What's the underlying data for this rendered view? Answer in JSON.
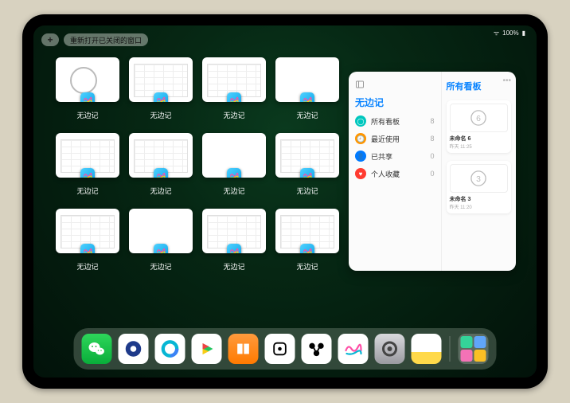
{
  "status": {
    "signal": "􀙇",
    "battery_text": "100%",
    "wifi": true
  },
  "top": {
    "plus_label": "+",
    "reopen_label": "重新打开已关闭的窗口"
  },
  "windows": [
    {
      "label": "无边记",
      "kind": "doodle"
    },
    {
      "label": "无边记",
      "kind": "grid"
    },
    {
      "label": "无边记",
      "kind": "grid"
    },
    {
      "label": "无边记",
      "kind": "blank"
    },
    {
      "label": "无边记",
      "kind": "grid"
    },
    {
      "label": "无边记",
      "kind": "grid"
    },
    {
      "label": "无边记",
      "kind": "blank"
    },
    {
      "label": "无边记",
      "kind": "grid"
    },
    {
      "label": "无边记",
      "kind": "grid"
    },
    {
      "label": "无边记",
      "kind": "blank"
    },
    {
      "label": "无边记",
      "kind": "grid"
    },
    {
      "label": "无边记",
      "kind": "grid"
    }
  ],
  "panel": {
    "title": "无边记",
    "right_title": "所有看板",
    "categories": [
      {
        "icon": "circle",
        "color": "#00c7be",
        "label": "所有看板",
        "count": 8
      },
      {
        "icon": "clock",
        "color": "#ff9500",
        "label": "最近使用",
        "count": 8
      },
      {
        "icon": "person",
        "color": "#007aff",
        "label": "已共享",
        "count": 0
      },
      {
        "icon": "heart",
        "color": "#ff3b30",
        "label": "个人收藏",
        "count": 0
      }
    ],
    "boards": [
      {
        "name": "未命名 6",
        "time": "昨天 11:25",
        "glyph": "6"
      },
      {
        "name": "未命名 3",
        "time": "昨天 11:20",
        "glyph": "3"
      }
    ]
  },
  "dock": {
    "apps": [
      {
        "name": "wechat",
        "bg": "linear-gradient(#2dd65a,#09ad3a)",
        "glyph": "wechat"
      },
      {
        "name": "browser1",
        "bg": "#ffffff",
        "glyph": "donut-blue"
      },
      {
        "name": "browser2",
        "bg": "#ffffff",
        "glyph": "ring-cyan"
      },
      {
        "name": "play",
        "bg": "#ffffff",
        "glyph": "play"
      },
      {
        "name": "books",
        "bg": "linear-gradient(#ff9a3d,#ff7a00)",
        "glyph": "books"
      },
      {
        "name": "dice",
        "bg": "#ffffff",
        "glyph": "dice"
      },
      {
        "name": "connect",
        "bg": "#ffffff",
        "glyph": "nodes"
      },
      {
        "name": "freeform",
        "bg": "#ffffff",
        "glyph": "freeform"
      },
      {
        "name": "settings",
        "bg": "linear-gradient(#d9d9dd,#9a9aa0)",
        "glyph": "gear"
      },
      {
        "name": "notes",
        "bg": "linear-gradient(#fff 60%,#ffd94a 60%)",
        "glyph": ""
      }
    ]
  }
}
